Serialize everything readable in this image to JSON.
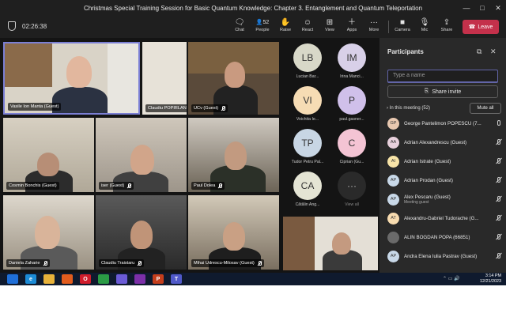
{
  "window": {
    "title": "Christmas Special Training Session for Basic Quantum Knowledge: Chapter 3. Entanglement and Quantum Teleportation"
  },
  "toolbar": {
    "timer": "02:26:38",
    "people_count": "52",
    "buttons": [
      {
        "label": "Chat",
        "icon": "chat-icon"
      },
      {
        "label": "People",
        "icon": "people-icon"
      },
      {
        "label": "Raise",
        "icon": "raise-hand-icon"
      },
      {
        "label": "React",
        "icon": "react-icon"
      },
      {
        "label": "View",
        "icon": "view-icon"
      },
      {
        "label": "Apps",
        "icon": "apps-icon"
      },
      {
        "label": "More",
        "icon": "more-icon"
      },
      {
        "label": "Camera",
        "icon": "camera-icon"
      },
      {
        "label": "Mic",
        "icon": "mic-icon"
      },
      {
        "label": "Share",
        "icon": "share-icon"
      }
    ],
    "leave_label": "Leave"
  },
  "tiles": [
    {
      "name": "Vasile Ion Manta (Guest)"
    },
    {
      "name": "Claudiu POPIRLAN"
    },
    {
      "name": "UCv (Guest)"
    },
    {
      "name": "Cosmin Bonchis (Guest)"
    },
    {
      "name": "iser (Guest)"
    },
    {
      "name": "Paul Dolea"
    },
    {
      "name": "Daniela Zaharie"
    },
    {
      "name": "Claudiu Traistaru"
    },
    {
      "name": "Mihai Udrescu-Milosav (Guest)"
    }
  ],
  "avatars": [
    {
      "initials": "LB",
      "name": "Lucian Bar...",
      "color": "#d8d8c8"
    },
    {
      "initials": "IM",
      "name": "Irina Manci...",
      "color": "#d8d0e8"
    },
    {
      "initials": "VI",
      "name": "Voichita Ie...",
      "color": "#f6dcb4"
    },
    {
      "initials": "P",
      "name": "paul.gasner...",
      "color": "#d0c0ea"
    },
    {
      "initials": "TP",
      "name": "Tudor Petru Pal...",
      "color": "#c8d6e4"
    },
    {
      "initials": "C",
      "name": "Ciprian (Gu...",
      "color": "#f4c4d4"
    },
    {
      "initials": "CA",
      "name": "Cătălin Ang...",
      "color": "#e4e4d4"
    },
    {
      "initials": "···",
      "name": "View all",
      "color": "#2a2a2a"
    }
  ],
  "panel": {
    "title": "Participants",
    "search_placeholder": "Type a name",
    "share_invite": "Share invite",
    "in_meeting": "In this meeting (52)",
    "mute_all": "Mute all",
    "participants": [
      {
        "initials": "GP",
        "name": "George Pantelimon POPESCU (7...",
        "sub": "",
        "color": "#e8c8b0",
        "mic": "on"
      },
      {
        "initials": "AA",
        "name": "Adrian Alexandrescu (Guest)",
        "sub": "",
        "color": "#e8d0dc",
        "mic": "off"
      },
      {
        "initials": "AI",
        "name": "Adrian Istrate (Guest)",
        "sub": "",
        "color": "#f8e4a8",
        "mic": "off"
      },
      {
        "initials": "AP",
        "name": "Adrian Prodan (Guest)",
        "sub": "",
        "color": "#c8d8e8",
        "mic": "off"
      },
      {
        "initials": "AP",
        "name": "Alex Pescaru (Guest)",
        "sub": "Meeting guest",
        "color": "#c8d8e8",
        "mic": "off"
      },
      {
        "initials": "AT",
        "name": "Alexandru-Gabriel Tudorache (G...",
        "sub": "",
        "color": "#f8dcb0",
        "mic": "off"
      },
      {
        "initials": "",
        "name": "ALIN BOGDAN POPA (66851)",
        "sub": "",
        "color": "#6a6a6a",
        "mic": "off"
      },
      {
        "initials": "AP",
        "name": "Andra Elena Iulia Pastrav (Guest)",
        "sub": "",
        "color": "#c8d8e8",
        "mic": "off"
      }
    ]
  },
  "taskbar": {
    "time": "3:14 PM",
    "date": "12/21/2023",
    "apps": [
      "windows-icon",
      "edge-icon",
      "explorer-icon",
      "firefox-icon",
      "opera-icon",
      "chrome-icon",
      "floppy-icon",
      "vpn-icon",
      "powerpoint-icon",
      "teams-icon"
    ],
    "app_labels": [
      "",
      "e",
      "",
      "",
      "O",
      "",
      "",
      "",
      "P",
      "T"
    ]
  }
}
